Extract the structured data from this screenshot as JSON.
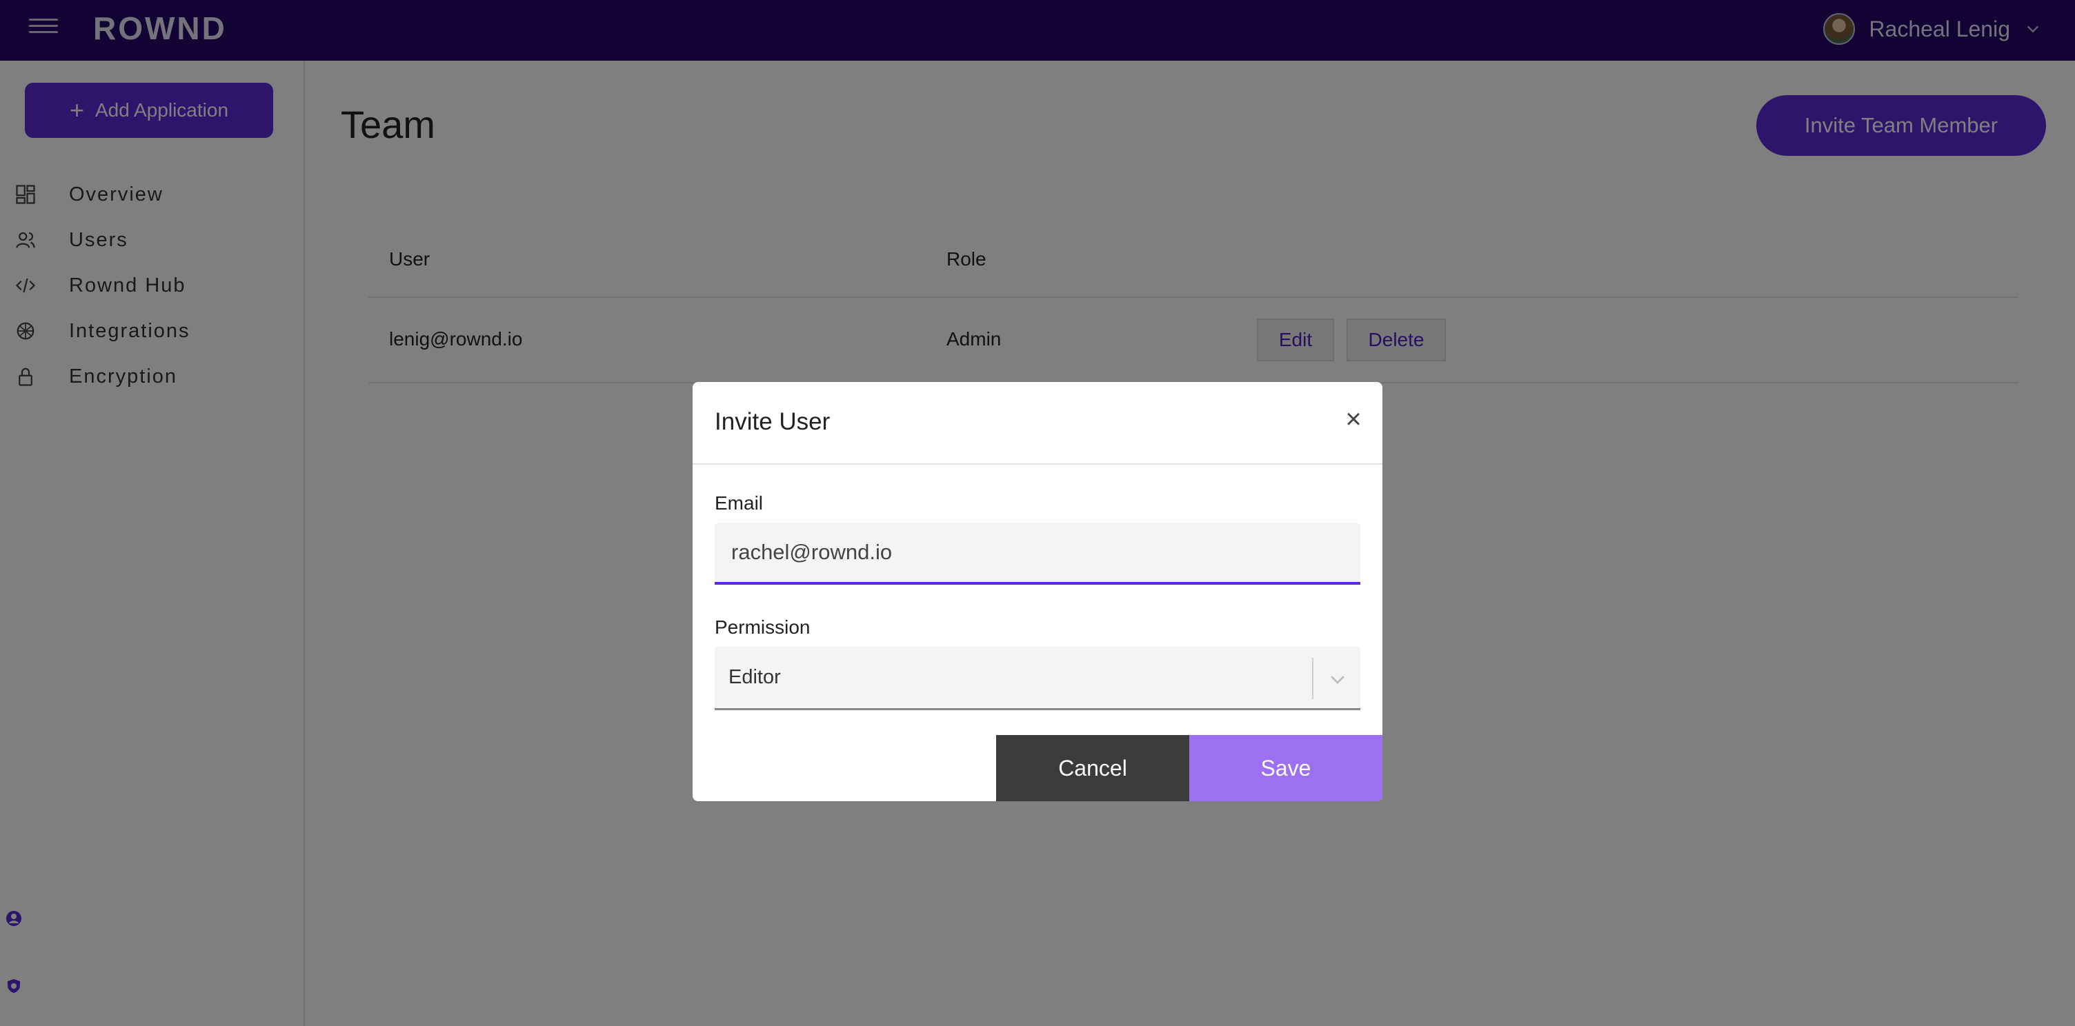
{
  "header": {
    "logo": "ROWND",
    "user_name": "Racheal Lenig"
  },
  "sidebar": {
    "add_application_label": "Add Application",
    "items": [
      {
        "label": "Overview",
        "icon": "dashboard-icon"
      },
      {
        "label": "Users",
        "icon": "users-icon"
      },
      {
        "label": "Rownd Hub",
        "icon": "code-icon"
      },
      {
        "label": "Integrations",
        "icon": "integrations-icon"
      },
      {
        "label": "Encryption",
        "icon": "lock-icon"
      }
    ]
  },
  "main": {
    "title": "Team",
    "invite_button_label": "Invite Team Member",
    "table": {
      "columns": [
        "User",
        "Role"
      ],
      "rows": [
        {
          "user": "lenig@rownd.io",
          "role": "Admin",
          "edit_label": "Edit",
          "delete_label": "Delete"
        }
      ]
    }
  },
  "modal": {
    "title": "Invite User",
    "close_symbol": "×",
    "email_label": "Email",
    "email_value": "rachel@rownd.io",
    "permission_label": "Permission",
    "permission_value": "Editor",
    "cancel_label": "Cancel",
    "save_label": "Save"
  },
  "colors": {
    "topbar": "#26066b",
    "accent": "#5b2bd9",
    "save": "#9c70f0",
    "cancel": "#3b3b3b"
  }
}
